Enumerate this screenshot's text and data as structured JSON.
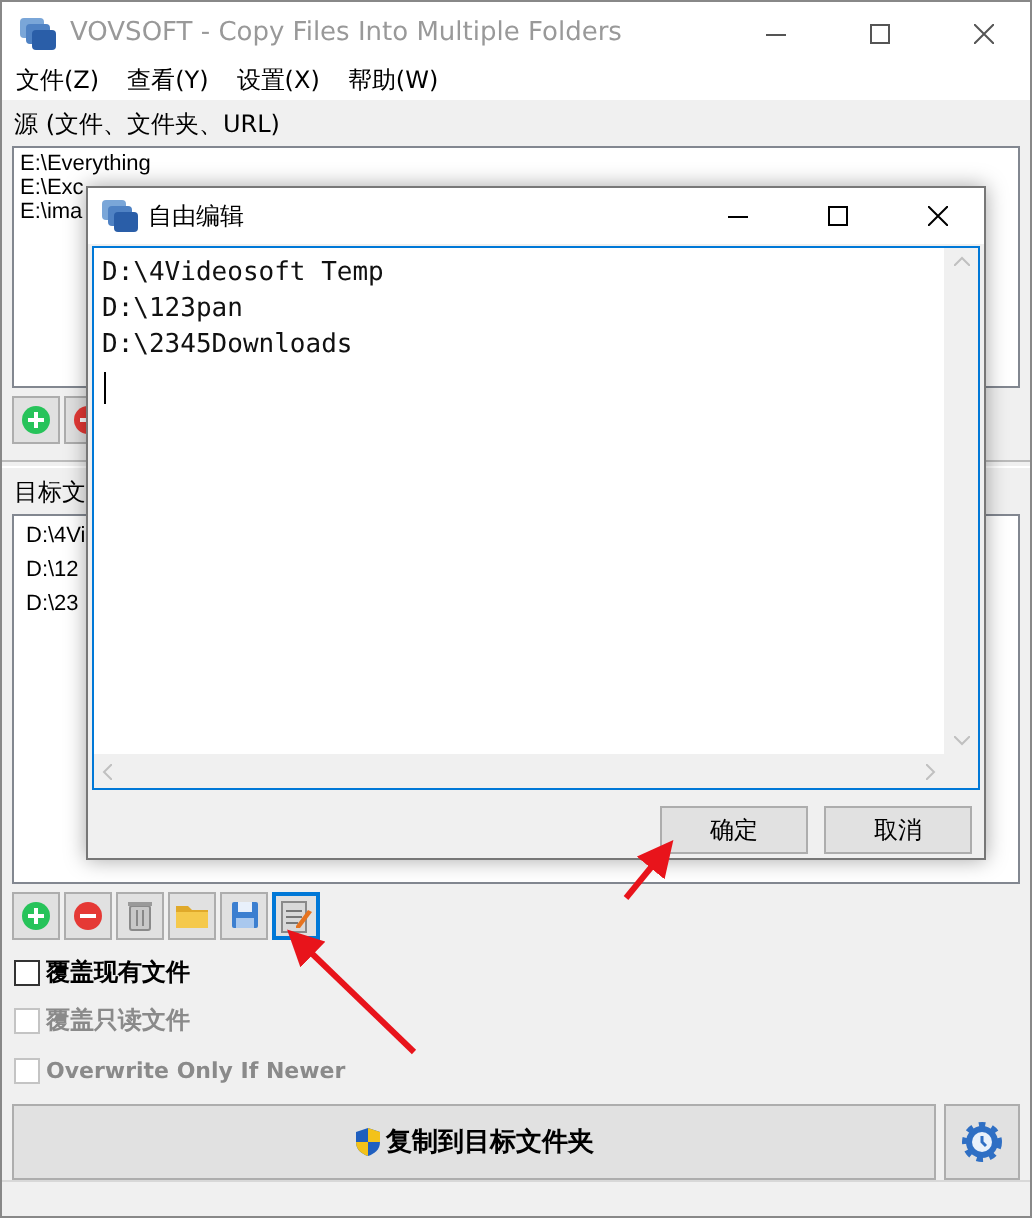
{
  "window": {
    "title": "VOVSOFT - Copy Files Into Multiple Folders"
  },
  "menu": [
    "文件(Z)",
    "查看(Y)",
    "设置(X)",
    "帮助(W)"
  ],
  "source": {
    "label": "源 (文件、文件夹、URL)",
    "items": [
      "E:\\Everything",
      "E:\\Exc",
      "E:\\ima"
    ],
    "tools": [
      {
        "kind": "add",
        "focused": false
      },
      {
        "kind": "remove",
        "focused": false
      }
    ]
  },
  "target": {
    "label": "目标文",
    "items": [
      "D:\\4Vi",
      "D:\\12",
      "D:\\23"
    ],
    "tools": [
      {
        "kind": "add",
        "focused": false
      },
      {
        "kind": "remove",
        "focused": false
      },
      {
        "kind": "trash",
        "focused": false
      },
      {
        "kind": "folder",
        "focused": false
      },
      {
        "kind": "save",
        "focused": false
      },
      {
        "kind": "edit",
        "focused": true
      }
    ]
  },
  "options": [
    {
      "label": "覆盖现有文件",
      "checked": false,
      "disabled": false
    },
    {
      "label": "覆盖只读文件",
      "checked": false,
      "disabled": true
    },
    {
      "label": "Overwrite Only If Newer",
      "checked": false,
      "disabled": true
    }
  ],
  "copy_button": {
    "label": "复制到目标文件夹"
  },
  "dialog": {
    "title": "自由编辑",
    "lines": [
      "D:\\4Videosoft Temp",
      "D:\\123pan",
      "D:\\2345Downloads"
    ],
    "buttons": [
      "确定",
      "取消"
    ]
  }
}
